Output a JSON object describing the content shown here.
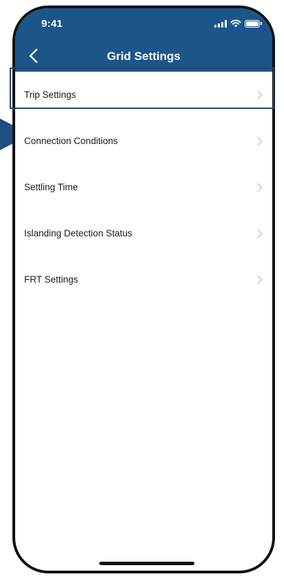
{
  "status_bar": {
    "time": "9:41"
  },
  "nav": {
    "title": "Grid Settings",
    "back_icon": "chevron-left-icon"
  },
  "menu": {
    "items": [
      {
        "label": "Trip Settings"
      },
      {
        "label": "Connection Conditions"
      },
      {
        "label": "Settling Time"
      },
      {
        "label": "Islanding Detection Status"
      },
      {
        "label": "FRT Settings"
      }
    ],
    "chevron_icon": "chevron-right-icon",
    "highlighted_item": "Trip Settings"
  },
  "colors": {
    "header_bg": "#1c5589",
    "highlight_border": "#25456b",
    "pointer": "#1c4f82",
    "chevron": "#c4c4c4"
  }
}
